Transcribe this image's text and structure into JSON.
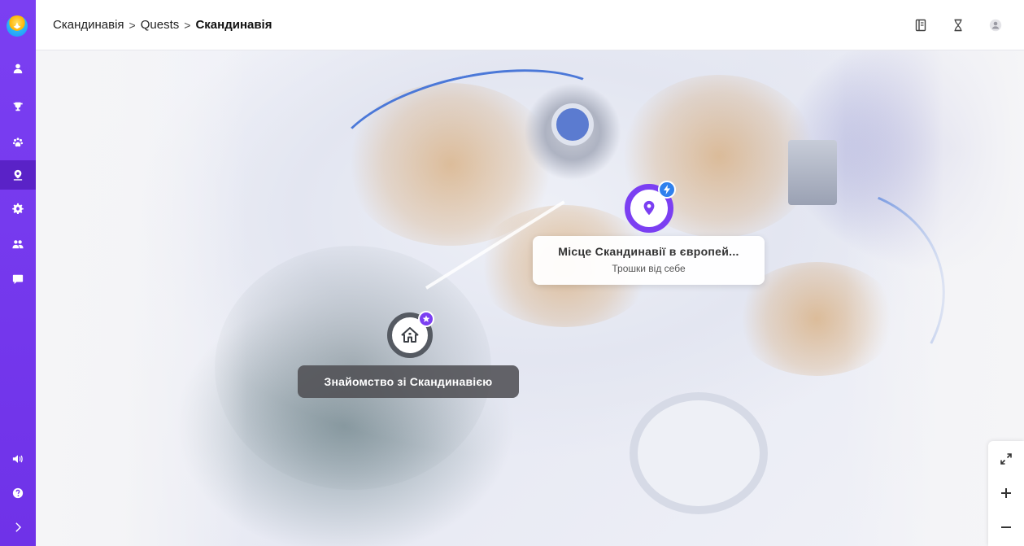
{
  "breadcrumb": {
    "items": [
      "Скандинавія",
      "Quests"
    ],
    "current": "Скандинавія",
    "separator": ">"
  },
  "sidebar": {
    "logo_icon": "app-logo-icon",
    "items": [
      {
        "icon": "user-icon",
        "active": false
      },
      {
        "icon": "trophy-icon",
        "active": false
      },
      {
        "icon": "paw-icon",
        "active": false
      },
      {
        "icon": "map-pin-icon",
        "active": true
      },
      {
        "icon": "gear-icon",
        "active": false
      },
      {
        "icon": "users-icon",
        "active": false
      },
      {
        "icon": "chat-icon",
        "active": false
      }
    ],
    "bottom_items": [
      {
        "icon": "volume-icon"
      },
      {
        "icon": "help-icon"
      },
      {
        "icon": "chevron-right-icon"
      }
    ],
    "accent": "#7b3ff2"
  },
  "header": {
    "icons": [
      "book-icon",
      "hourglass-icon",
      "account-icon"
    ]
  },
  "map": {
    "markers": [
      {
        "type": "home",
        "label": "Знайомство зі Скандинавією",
        "badge": "star-icon"
      },
      {
        "type": "quest",
        "title": "Місце Скандинавії в європей...",
        "subtitle": "Трошки від себе",
        "badge": "bolt-icon"
      }
    ],
    "controls": [
      "expand-icon",
      "zoom-in-icon",
      "zoom-out-icon"
    ]
  }
}
